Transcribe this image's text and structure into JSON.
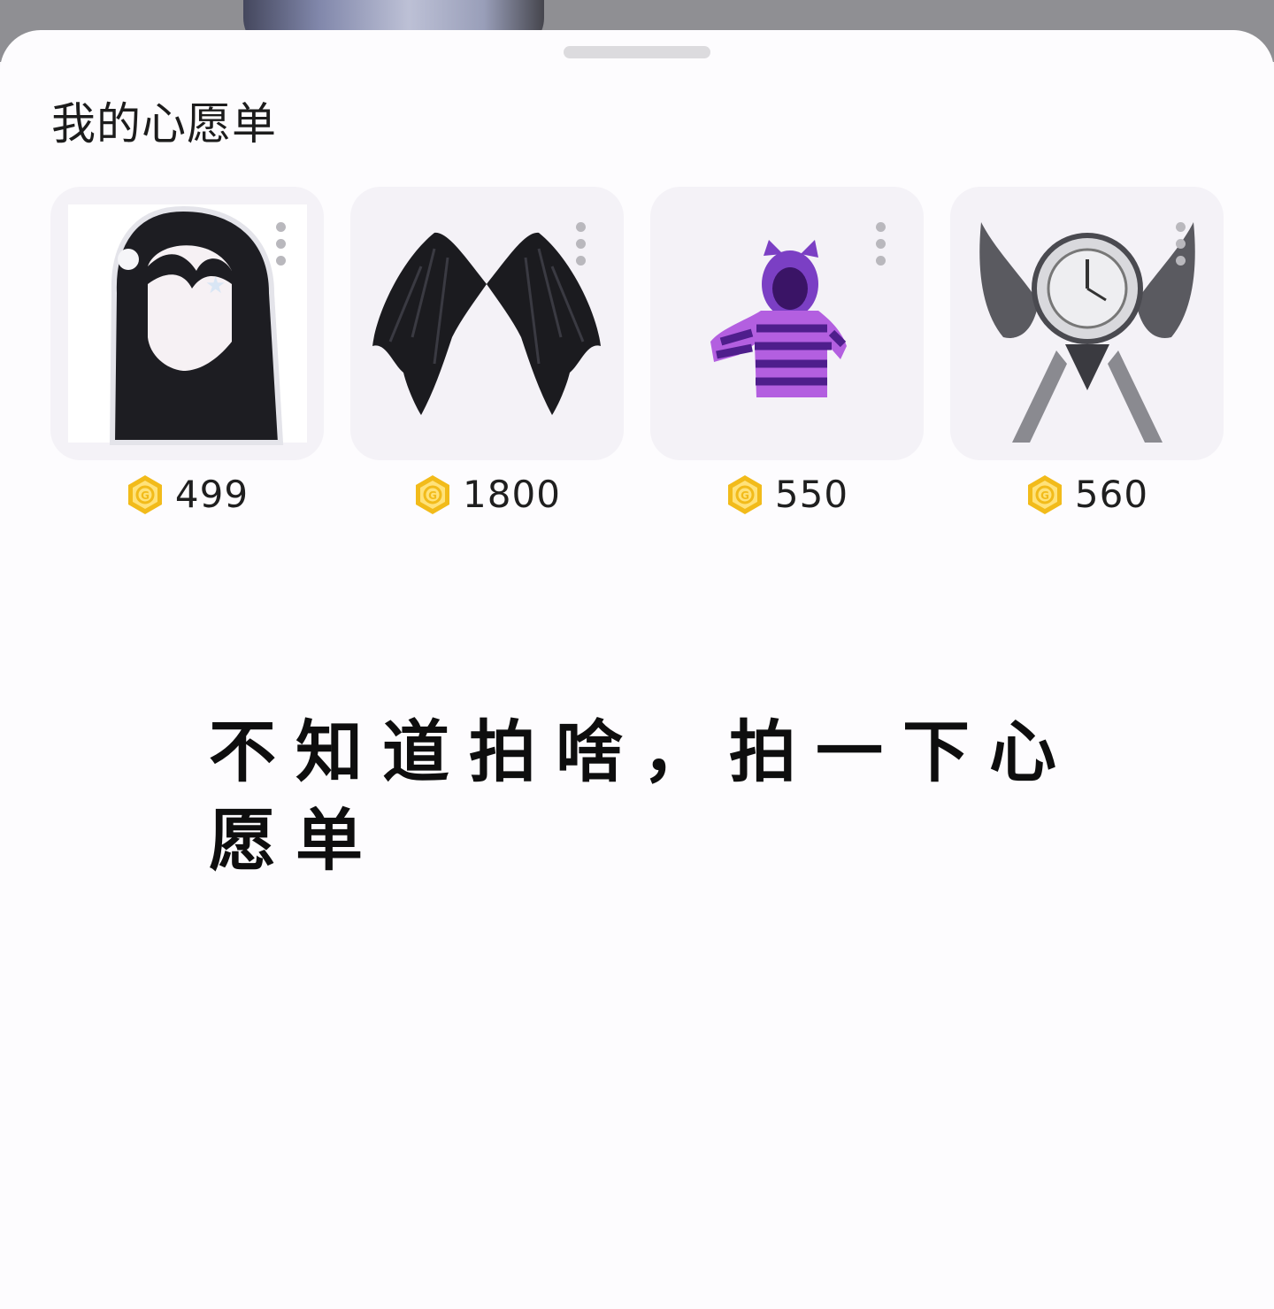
{
  "sheet": {
    "title": "我的心愿单"
  },
  "wishlist": {
    "items": [
      {
        "name": "long black hair",
        "price": "499",
        "icon": "coin-icon"
      },
      {
        "name": "black wings",
        "price": "1800",
        "icon": "coin-icon"
      },
      {
        "name": "purple striped cat hoodie",
        "price": "550",
        "icon": "coin-icon"
      },
      {
        "name": "winged clock accessory",
        "price": "560",
        "icon": "coin-icon"
      }
    ]
  },
  "caption": {
    "text": "不知道拍啥，拍一下心愿单"
  },
  "colors": {
    "coin": "#f2bb1a",
    "sheet_background": "#fdfcfe",
    "thumb_background": "#f4f2f7",
    "text": "#1c1c1c"
  }
}
